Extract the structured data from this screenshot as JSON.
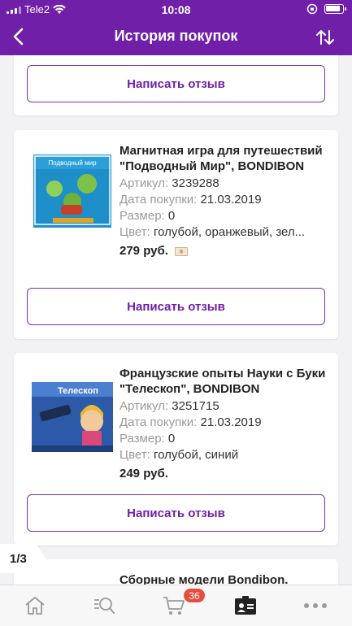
{
  "status_bar": {
    "carrier": "Tele2",
    "time": "10:08"
  },
  "header": {
    "title": "История покупок"
  },
  "write_review_label": "Написать отзыв",
  "products": [
    {
      "name": "Магнитная игра для путешествий \"Подводный Мир\", BONDIBON",
      "article_label": "Артикул:",
      "article": "3239288",
      "date_label": "Дата покупки:",
      "date": "21.03.2019",
      "size_label": "Размер:",
      "size": "0",
      "color_label": "Цвет:",
      "color": "голубой, оранжевый, зел...",
      "price": "279 руб.",
      "thumb_text": "Подводный мир"
    },
    {
      "name": "Французские опыты Науки с Буки \"Телескоп\", BONDIBON",
      "article_label": "Артикул:",
      "article": "3251715",
      "date_label": "Дата покупки:",
      "date": "21.03.2019",
      "size_label": "Размер:",
      "size": "0",
      "color_label": "Цвет:",
      "color": "голубой, синий",
      "price": "249 руб.",
      "thumb_text": "Телескоп"
    },
    {
      "name": "Сборные модели Bondibon."
    }
  ],
  "pager": "1/3",
  "tabbar": {
    "items": [
      "home-icon",
      "search-icon",
      "cart-icon",
      "profile-card-icon",
      "more-icon"
    ],
    "cart_badge": "36"
  },
  "colors": {
    "accent": "#6f1fa8",
    "badge": "#e74c3c"
  }
}
